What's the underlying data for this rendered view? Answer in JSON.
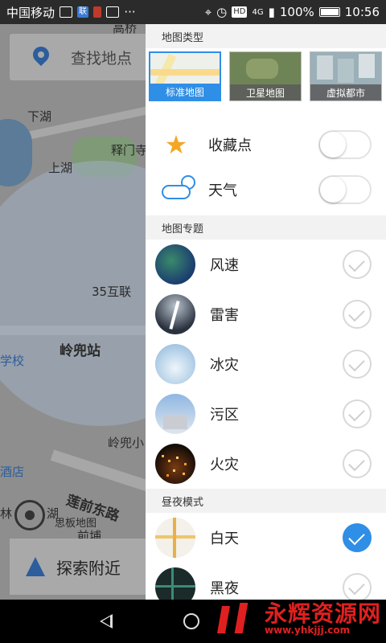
{
  "status_bar": {
    "carrier": "中国移动",
    "notif_badge": "联",
    "signal": "4G",
    "battery": "100%",
    "time": "10:56"
  },
  "map": {
    "search_placeholder": "查找地点",
    "nearby_label": "探索附近",
    "labels": [
      "高桥",
      "下湖",
      "上湖",
      "释门寺",
      "35互联",
      "岭兜站",
      "学校",
      "岭兜小",
      "莲前东路",
      "思板地图",
      "前埔",
      "酒店",
      "林",
      "湖"
    ]
  },
  "drawer": {
    "map_type_header": "地图类型",
    "map_types": [
      {
        "label": "标准地图",
        "selected": true
      },
      {
        "label": "卫星地图",
        "selected": false
      },
      {
        "label": "虚拟都市",
        "selected": false
      }
    ],
    "layers": [
      {
        "label": "收藏点",
        "icon": "star-icon",
        "on": false
      },
      {
        "label": "天气",
        "icon": "weather-icon",
        "on": false
      }
    ],
    "theme_header": "地图专题",
    "themes": [
      {
        "label": "风速",
        "checked": false
      },
      {
        "label": "雷害",
        "checked": false
      },
      {
        "label": "冰灾",
        "checked": false
      },
      {
        "label": "污区",
        "checked": false
      },
      {
        "label": "火灾",
        "checked": false
      }
    ],
    "daynight_header": "昼夜模式",
    "daynight": [
      {
        "label": "白天",
        "checked": true
      },
      {
        "label": "黑夜",
        "checked": false
      }
    ]
  },
  "watermark": {
    "text": "永辉资源网",
    "url": "www.yhkjjj.com"
  },
  "colors": {
    "accent": "#2f8ee6",
    "star": "#f5a623",
    "watermark": "#e02020"
  }
}
